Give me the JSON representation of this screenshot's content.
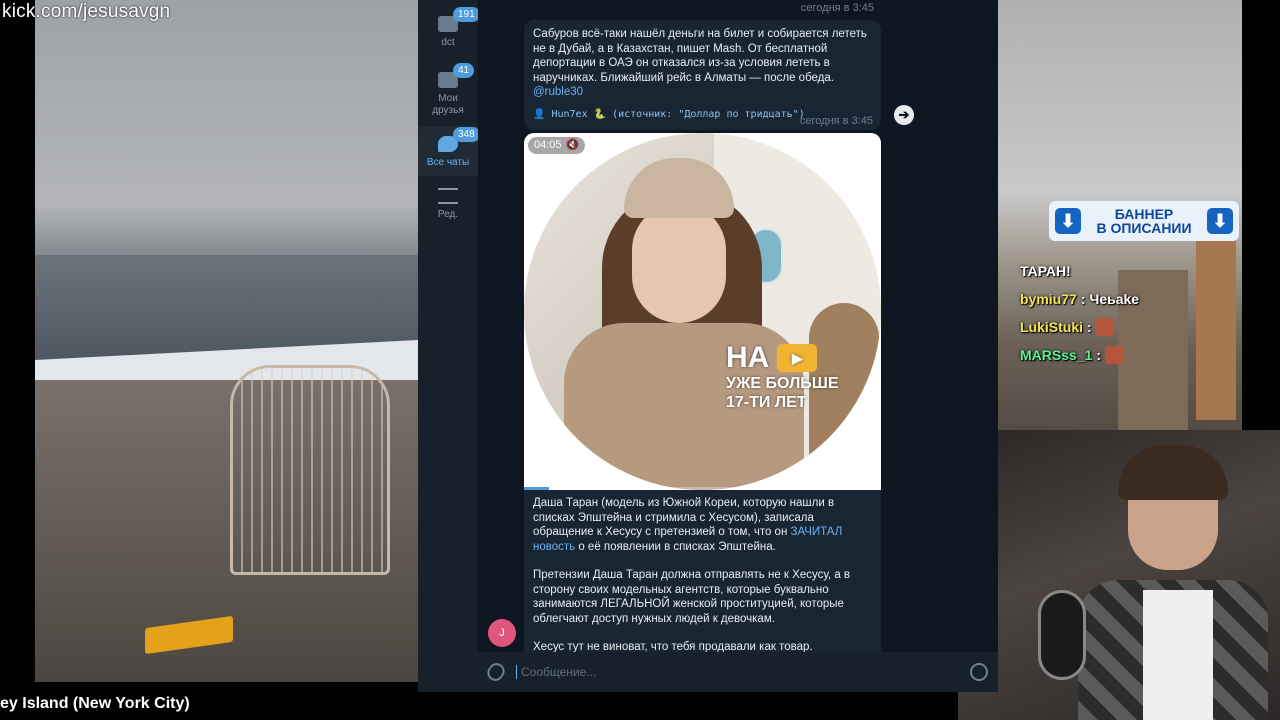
{
  "stream": {
    "kick_url": "kick.com/jesusavgn",
    "location": "ey Island (New York City)"
  },
  "banner": {
    "line1": "БАННЕР",
    "line2": "В ОПИСАНИИ",
    "arrow": "⬇"
  },
  "chat": {
    "partial_message": "ТАРАН!",
    "messages": [
      {
        "user": "bymiu77",
        "sep": ":",
        "text": "Чeьake"
      },
      {
        "user": "LukiStuki",
        "sep": ":",
        "text": ""
      },
      {
        "user": "MARSss_1",
        "sep": ":",
        "text": ""
      }
    ]
  },
  "telegram": {
    "folders": [
      {
        "label": "dct",
        "badge": "191",
        "icon": "folder-icon"
      },
      {
        "label": "Мои друзья",
        "badge": "41",
        "icon": "folder-icon"
      },
      {
        "label": "Все чаты",
        "badge": "348",
        "icon": "chats-icon"
      },
      {
        "label": "Ред.",
        "badge": "",
        "icon": "settings-sliders-icon"
      }
    ],
    "top_time": "сегодня в 3:45",
    "message1": {
      "text": "Сабуров всё-таки нашёл деньги на билет и собирается лететь не в Дубай, а в Казахстан, пишет Mash. От бесплатной депортации в ОАЭ он отказался из-за условия лететь в наручниках. Ближайший рейс в Алматы — после обеда.",
      "mention": "@ruble30",
      "signature": "👤 Hun7ex 🐍 (источник: \"Доллар по тридцать\")",
      "time": "сегодня в 3:45"
    },
    "video": {
      "duration": "04:05",
      "mute_icon": "🔇",
      "overlay_big": "НА",
      "overlay_line1": "УЖЕ БОЛЬШЕ",
      "overlay_line2": "17-ТИ ЛЕТ",
      "play_icon": "▶",
      "progress": 0.07
    },
    "caption": {
      "p1_before": "Даша Таран (модель из Южной Кореи, которую нашли в списках Эпштейна и стримила с Хесусом), записала обращение к Хесусу с претензией о том, что он ",
      "p1_link": "ЗАЧИТАЛ новость",
      "p1_after": " о её появлении в списках Эпштейна.",
      "p2": "Претензии Даша Таран должна отправлять не к Хесусу, а в сторону своих модельных агентств, которые буквально занимаются ЛЕГАЛЬНОЙ женской проституцией, которые облегчают доступ нужных людей к девочкам.",
      "p3": "Хесус тут не виноват, что тебя продавали как товар."
    },
    "avatar_letter": "J",
    "composer_placeholder": "Сообщение...",
    "accent_color": "#4f9bdb"
  }
}
